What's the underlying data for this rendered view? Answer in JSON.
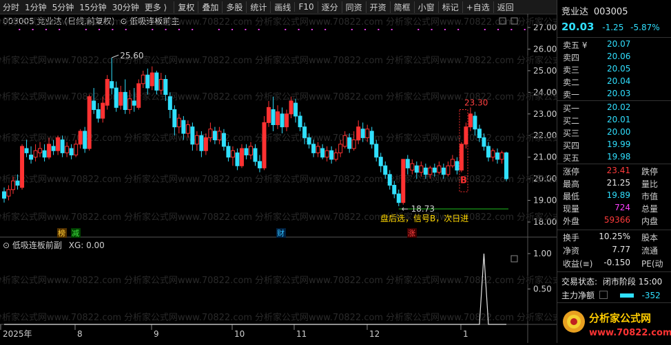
{
  "toolbar": {
    "left_items": [
      "分时",
      "1分钟",
      "5分钟",
      "15分钟",
      "30分钟",
      "更多 ⟩"
    ],
    "right_items": [
      "复权",
      "叠加",
      "多股",
      "统计",
      "画线",
      "F10",
      "逐分",
      "同资",
      "开资",
      "简框",
      "小窗",
      "标记",
      "+自选",
      "返回"
    ]
  },
  "main_panel": {
    "title": "003005 竞业达 (日线,前复权)",
    "indicator": "低吸连板前主",
    "annotations": {
      "high_label": "25.60",
      "recent_high_label": "23.30",
      "low_label": "18.73",
      "signal_text": "盘后选，信号B，次日进",
      "signal_letter": "B"
    },
    "event_tags": [
      "榜",
      "减",
      "财",
      "涨"
    ]
  },
  "sub_panel": {
    "title": "低吸连板前副",
    "xg_label": "XG: 0.00"
  },
  "x_axis": {
    "labels": [
      "2025年",
      "8",
      "9",
      "10",
      "11",
      "12",
      "1"
    ]
  },
  "y_axis_main": [
    "27.00",
    "26.00",
    "25.00",
    "24.00",
    "23.00",
    "22.00",
    "21.00",
    "20.00",
    "19.00",
    "18.00"
  ],
  "y_axis_sub": [
    "1.00",
    "0.50"
  ],
  "watermark": "分析家公式网www.70822.com",
  "quote": {
    "name": "竞业达",
    "code": "003005",
    "price": "20.03",
    "change": "-1.25",
    "change_pct": "-5.87%",
    "asks": [
      {
        "label": "卖五 ¥",
        "price": "20.07"
      },
      {
        "label": "卖四",
        "price": "20.06"
      },
      {
        "label": "卖三",
        "price": "20.05"
      },
      {
        "label": "卖二",
        "price": "20.04"
      },
      {
        "label": "卖一",
        "price": "20.03"
      }
    ],
    "bids": [
      {
        "label": "买一",
        "price": "20.02"
      },
      {
        "label": "买二",
        "price": "20.01"
      },
      {
        "label": "买三",
        "price": "20.00"
      },
      {
        "label": "买四",
        "price": "19.99"
      },
      {
        "label": "买五",
        "price": "19.98"
      }
    ],
    "stats": [
      {
        "label": "涨停",
        "value": "23.41",
        "label2": "跌停"
      },
      {
        "label": "最高",
        "value": "21.25",
        "label2": "量比"
      },
      {
        "label": "最低",
        "value": "19.89",
        "label2": "市值"
      },
      {
        "label": "现量",
        "value": "724",
        "label2": "总量"
      },
      {
        "label": "外盘",
        "value": "59366",
        "label2": "内盘"
      }
    ],
    "stats2": [
      {
        "label": "换手",
        "value": "10.25%",
        "label2": "股本"
      },
      {
        "label": "净资",
        "value": "7.77",
        "label2": "流通"
      },
      {
        "label": "收益(≡)",
        "value": "-0.150",
        "label2": "PE(动"
      }
    ],
    "trade_state_label": "交易状态:",
    "trade_state": "闭市阶段 15:00",
    "main_net_label": "主力净额",
    "main_net_value": "-352"
  },
  "logo": {
    "text": "分析家公式网",
    "url_text": "www.70822.com"
  },
  "colors": {
    "up": "#ff3232",
    "down": "#30e0ff",
    "bg": "#000000",
    "accent": "#ff40ff"
  }
}
